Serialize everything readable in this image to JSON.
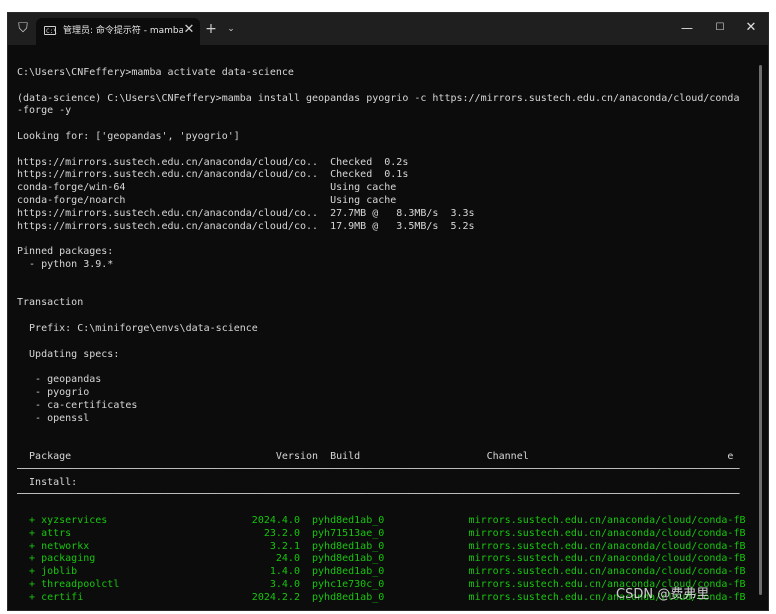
{
  "titlebar": {
    "tab_title": "管理员: 命令提示符 - mamba",
    "tab_close_glyph": "✕",
    "new_tab_glyph": "+",
    "dropdown_glyph": "⌄",
    "minimize_glyph": "—",
    "maximize_glyph": "☐",
    "close_glyph": "✕",
    "shield_glyph": "⛉",
    "tab_icon_glyph": "C:\\"
  },
  "terminal": {
    "lines": [
      "C:\\Users\\CNFeffery>mamba activate data-science",
      "",
      "(data-science) C:\\Users\\CNFeffery>mamba install geopandas pyogrio -c https://mirrors.sustech.edu.cn/anaconda/cloud/conda",
      "-forge -y",
      "",
      "Looking for: ['geopandas', 'pyogrio']",
      "",
      "https://mirrors.sustech.edu.cn/anaconda/cloud/co..  Checked  0.2s",
      "https://mirrors.sustech.edu.cn/anaconda/cloud/co..  Checked  0.1s",
      "conda-forge/win-64                                  Using cache",
      "conda-forge/noarch                                  Using cache",
      "https://mirrors.sustech.edu.cn/anaconda/cloud/co..  27.7MB @   8.3MB/s  3.3s",
      "https://mirrors.sustech.edu.cn/anaconda/cloud/co..  17.9MB @   3.5MB/s  5.2s",
      "",
      "Pinned packages:",
      "  - python 3.9.*",
      "",
      "",
      "Transaction",
      "",
      "  Prefix: C:\\miniforge\\envs\\data-science",
      "",
      "  Updating specs:",
      "",
      "   - geopandas",
      "   - pyogrio",
      "   - ca-certificates",
      "   - openssl",
      "",
      "",
      "  Package                                  Version  Build                     Channel                                 e",
      "────────────────────────────────────────────────────────────────────────────────────────────────────────────────────────",
      "  Install:",
      "────────────────────────────────────────────────────────────────────────────────────────────────────────────────────────",
      ""
    ],
    "packages": [
      {
        "name": "  + xyzservices  ",
        "rest": "                      2024.4.0  pyhd8ed1ab_0              mirrors.sustech.edu.cn/anaconda/cloud/conda-fB"
      },
      {
        "name": "  + attrs        ",
        "rest": "                        23.2.0  pyh71513ae_0              mirrors.sustech.edu.cn/anaconda/cloud/conda-fB"
      },
      {
        "name": "  + networkx     ",
        "rest": "                         3.2.1  pyhd8ed1ab_0              mirrors.sustech.edu.cn/anaconda/cloud/conda-fB"
      },
      {
        "name": "  + packaging    ",
        "rest": "                          24.0  pyhd8ed1ab_0              mirrors.sustech.edu.cn/anaconda/cloud/conda-fB"
      },
      {
        "name": "  + joblib       ",
        "rest": "                         1.4.0  pyhd8ed1ab_0              mirrors.sustech.edu.cn/anaconda/cloud/conda-fB"
      },
      {
        "name": "  + threadpoolctl",
        "rest": "                         3.4.0  pyhc1e730c_0              mirrors.sustech.edu.cn/anaconda/cloud/conda-fB"
      },
      {
        "name": "  + certifi      ",
        "rest": "                      2024.2.2  pyhd8ed1ab_0              mirrors.sustech.edu.cn/anaconda/cloud/conda-fB"
      }
    ]
  },
  "watermark": "CSDN @费弗里",
  "colors": {
    "terminal_bg": "#0c0c0c",
    "terminal_fg": "#d7d7d7",
    "titlebar_bg": "#1f1f1f",
    "package_green": "#16c60c"
  }
}
